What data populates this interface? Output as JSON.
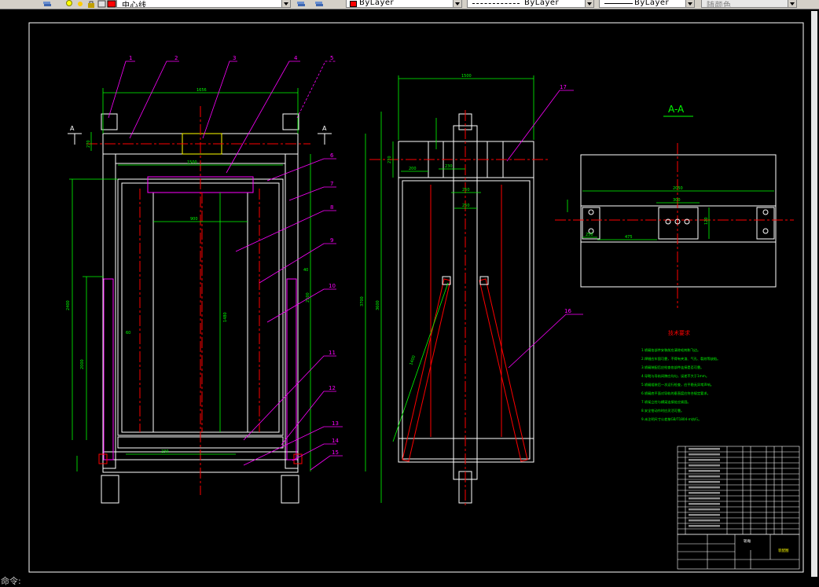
{
  "toolbar": {
    "layer_name": "中心线",
    "color_value": "ByLayer",
    "linetype_value": "ByLayer",
    "lineweight_value": "ByLayer",
    "plotstyle_value": "随颜色",
    "icons": [
      "layer-manager-icon",
      "lightbulb-icon",
      "sun-icon",
      "lock-icon",
      "layer-color-icon",
      "make-current-icon",
      "layer-previous-icon"
    ],
    "colors": {
      "layer_swatch": "#ff0000",
      "color_swatch": "#ff0000"
    }
  },
  "drawing": {
    "colors": {
      "background": "#000000",
      "frame": "#ffffff",
      "dims": "#00ff00",
      "leaders": "#ff00ff",
      "centerlines": "#ff0000",
      "notes": "#00ff00",
      "yellow": "#ffff00"
    },
    "section_label": "A-A",
    "cut_marker": "A",
    "balloons": [
      "1",
      "2",
      "3",
      "4",
      "5",
      "6",
      "7",
      "8",
      "9",
      "10",
      "11",
      "12",
      "13",
      "14",
      "15",
      "16",
      "17"
    ],
    "tech_req_title": "技术要求",
    "tech_notes": [
      "1.轿厢各部件安装前应清除毛刺和飞边。",
      "2.焊缝应牢固可靠，不得有夹渣、气孔、裂纹等缺陷。",
      "3.轿厢装配后应检查各部件连接是否可靠。",
      "4.导靴与导轨间隙应均匀，误差不大于1mm。",
      "5.轿厢组装后一次运行检查，应平稳无异常声响。",
      "6.轿厢底平面对导轨的垂直度应符合规定要求。",
      "7.轿架立柱与横梁连接处应紧固。",
      "8.安全钳动作时应灵活可靠。",
      "9.未注明尺寸公差按GB/T1804-m执行。"
    ],
    "dims": {
      "front_width": "1656",
      "frame_inner": "1500",
      "door_width": "900",
      "inner_half": "1480",
      "door_height": "2000",
      "car_height": "2400",
      "sill": "2500",
      "side_width": "1500",
      "side_depth": "1540",
      "total_height": "3700",
      "side_h2": "3600",
      "beam": "270",
      "gap1": "200",
      "gap2": "230",
      "x1": "250",
      "x2": "250",
      "aa_width": "2050",
      "aa_hole": "300",
      "aa_left": "250",
      "aa_mid": "475",
      "aa_h": "120",
      "bot": "230",
      "brace": "1400",
      "small1": "60",
      "small2": "40"
    },
    "bom_rows": 16,
    "title_block": {
      "drawing_name": "轿厢",
      "material": "装配图"
    }
  }
}
